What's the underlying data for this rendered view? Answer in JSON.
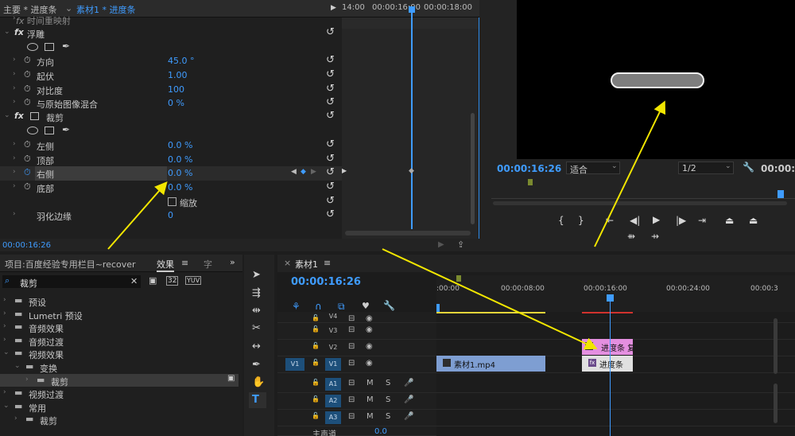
{
  "effect_controls": {
    "tab_main": "主要 * 进度条",
    "tab_active": "素材1 * 进度条",
    "section_remap": "时间重映射",
    "emboss": {
      "title": "浮雕",
      "params": [
        {
          "label": "方向",
          "value": "45.0 °"
        },
        {
          "label": "起伏",
          "value": "1.00"
        },
        {
          "label": "对比度",
          "value": "100"
        },
        {
          "label": "与原始图像混合",
          "value": "0 %"
        }
      ]
    },
    "crop": {
      "title": "裁剪",
      "params": [
        {
          "label": "左侧",
          "value": "0.0 %"
        },
        {
          "label": "顶部",
          "value": "0.0 %"
        },
        {
          "label": "右侧",
          "value": "0.0 %"
        },
        {
          "label": "底部",
          "value": "0.0 %"
        }
      ],
      "zoom_label": "缩放",
      "feather_label": "羽化边缘",
      "feather_value": "0"
    },
    "ruler": [
      "14:00",
      "00:00:16:00",
      "00:00:18:00"
    ],
    "timecode": "00:00:16:26"
  },
  "program": {
    "timecode": "00:00:16:26",
    "fit": "适合",
    "resolution": "1/2",
    "duration": "00:00:"
  },
  "project": {
    "title": "项目:百度经验专用栏目~recover",
    "tab_effects": "效果",
    "tab_menu": "≡",
    "tab_more": "字",
    "search_value": "裁剪",
    "badges": [
      "32",
      "YUV"
    ],
    "tree": [
      {
        "label": "预设",
        "indent": 0,
        "open": false
      },
      {
        "label": "Lumetri 预设",
        "indent": 0,
        "open": false
      },
      {
        "label": "音频效果",
        "indent": 0,
        "open": false
      },
      {
        "label": "音频过渡",
        "indent": 0,
        "open": false
      },
      {
        "label": "视频效果",
        "indent": 0,
        "open": true
      },
      {
        "label": "变换",
        "indent": 1,
        "open": true
      },
      {
        "label": "裁剪",
        "indent": 2,
        "open": false
      },
      {
        "label": "视频过渡",
        "indent": 0,
        "open": false
      },
      {
        "label": "常用",
        "indent": 0,
        "open": true
      },
      {
        "label": "裁剪",
        "indent": 1,
        "open": false
      }
    ]
  },
  "sequence": {
    "tab": "素材1",
    "timecode": "00:00:16:26",
    "ruler": [
      ":00:00",
      "00:00:08:00",
      "00:00:16:00",
      "00:00:24:00",
      "00:00:3"
    ],
    "tracks": [
      {
        "name": "V4",
        "src": ""
      },
      {
        "name": "V3",
        "src": ""
      },
      {
        "name": "V2",
        "src": ""
      },
      {
        "name": "V1",
        "src": "V1"
      },
      {
        "name": "A1",
        "src": ""
      },
      {
        "name": "A2",
        "src": ""
      },
      {
        "name": "A3",
        "src": ""
      }
    ],
    "m": "M",
    "s": "S",
    "master": "主声道",
    "master_value": "0.0",
    "clips": {
      "v2": "进度条 复",
      "v1_main": "素材1.mp4",
      "v1_fx": "进度条"
    }
  },
  "colors": {
    "accent": "#3f9cff",
    "clip_pink": "#e48fe0",
    "clip_blue": "#7e9ed2",
    "arrow": "#f2e600"
  }
}
